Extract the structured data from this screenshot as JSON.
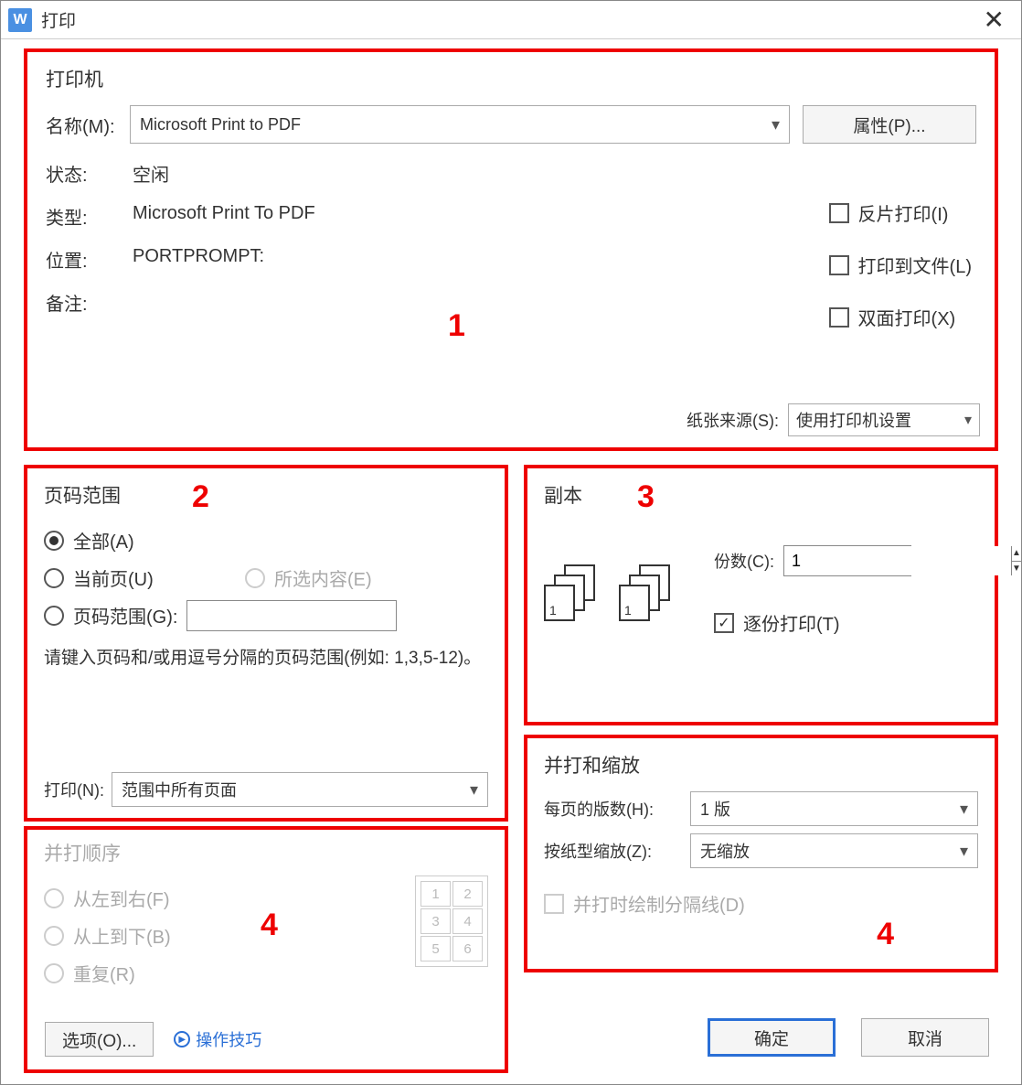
{
  "title": "打印",
  "app_icon_letter": "W",
  "printer": {
    "section": "打印机",
    "name_label": "名称(M):",
    "name_value": "Microsoft Print to PDF",
    "props_btn": "属性(P)...",
    "status_label": "状态:",
    "status_value": "空闲",
    "type_label": "类型:",
    "type_value": "Microsoft Print To PDF",
    "location_label": "位置:",
    "location_value": "PORTPROMPT:",
    "comment_label": "备注:",
    "comment_value": "",
    "invert_print": "反片打印(I)",
    "print_to_file": "打印到文件(L)",
    "duplex": "双面打印(X)",
    "paper_source_label": "纸张来源(S):",
    "paper_source_value": "使用打印机设置"
  },
  "page_range": {
    "section": "页码范围",
    "all": "全部(A)",
    "current": "当前页(U)",
    "selection": "所选内容(E)",
    "pages": "页码范围(G):",
    "hint": "请键入页码和/或用逗号分隔的页码范围(例如: 1,3,5-12)。",
    "print_label": "打印(N):",
    "print_value": "范围中所有页面"
  },
  "copies": {
    "section": "副本",
    "copies_label": "份数(C):",
    "copies_value": "1",
    "collate": "逐份打印(T)"
  },
  "scaling": {
    "section": "并打和缩放",
    "per_sheet_label": "每页的版数(H):",
    "per_sheet_value": "1 版",
    "scale_label": "按纸型缩放(Z):",
    "scale_value": "无缩放",
    "draw_border": "并打时绘制分隔线(D)"
  },
  "print_order": {
    "section": "并打顺序",
    "ltr": "从左到右(F)",
    "ttb": "从上到下(B)",
    "repeat": "重复(R)"
  },
  "options_btn": "选项(O)...",
  "tips_link": "操作技巧",
  "ok_btn": "确定",
  "cancel_btn": "取消",
  "annotations": {
    "a1": "1",
    "a2": "2",
    "a3": "3",
    "a4": "4"
  }
}
